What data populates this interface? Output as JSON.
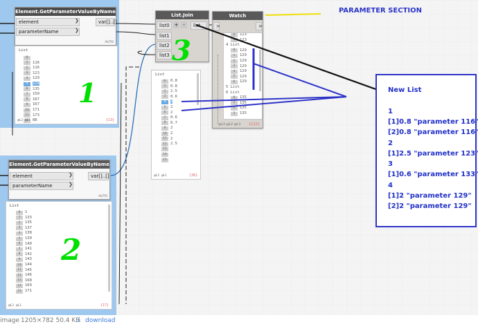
{
  "node_getparam_1": {
    "title": "Element.GetParameterValueByName",
    "inputs": [
      "element",
      "parameterName"
    ],
    "output": "var[]..[]",
    "lacing": "AUTO",
    "preview": {
      "title": "List",
      "items": [
        [
          "0",
          ""
        ],
        [
          "1",
          "116"
        ],
        [
          "2",
          "116"
        ],
        [
          "3",
          "123"
        ],
        [
          "4",
          "129"
        ],
        [
          "5",
          "129"
        ],
        [
          "6",
          "135"
        ],
        [
          "7",
          "150"
        ],
        [
          "8",
          "167"
        ],
        [
          "9",
          "167"
        ],
        [
          "10",
          "171"
        ],
        [
          "11",
          "173"
        ],
        [
          "12",
          "88"
        ]
      ],
      "highlight_index": 5,
      "levels": "@L2 @L1",
      "count": "{13}"
    }
  },
  "node_getparam_2": {
    "title": "Element.GetParameterValueByName",
    "inputs": [
      "element",
      "parameterName"
    ],
    "output": "var[]..[]",
    "lacing": "AUTO",
    "preview": {
      "title": "List",
      "items": [
        [
          "0",
          "1"
        ],
        [
          "1",
          "133"
        ],
        [
          "2",
          "135"
        ],
        [
          "3",
          "137"
        ],
        [
          "4",
          "138"
        ],
        [
          "5",
          "139"
        ],
        [
          "6",
          "140"
        ],
        [
          "7",
          "141"
        ],
        [
          "8",
          "142"
        ],
        [
          "9",
          "143"
        ],
        [
          "10",
          "144"
        ],
        [
          "11",
          "145"
        ],
        [
          "12",
          "146"
        ],
        [
          "13",
          "168"
        ],
        [
          "14",
          "169"
        ],
        [
          "15",
          "171"
        ]
      ],
      "levels": "@L2 @L1",
      "count": "{17}"
    }
  },
  "node_listjoin": {
    "title": "List.Join",
    "inputs": [
      "list0",
      "list1",
      "list2",
      "list3"
    ],
    "plus": "+",
    "minus": "-",
    "output": "list",
    "preview": {
      "title": "List",
      "items": [
        [
          "0",
          "0.8"
        ],
        [
          "1",
          "0.8"
        ],
        [
          "2",
          "2.5"
        ],
        [
          "3",
          "0.6"
        ],
        [
          "4",
          "2"
        ],
        [
          "5",
          "2"
        ],
        [
          "6",
          "2"
        ],
        [
          "7",
          "0.6"
        ],
        [
          "8",
          "0.7"
        ],
        [
          "9",
          "2"
        ],
        [
          "10",
          "2"
        ],
        [
          "11",
          "2"
        ],
        [
          "12",
          "2.5"
        ],
        [
          "13",
          ""
        ],
        [
          "14",
          ""
        ],
        [
          "15",
          ""
        ]
      ],
      "highlight_index": 4,
      "levels": "@L2 @L1",
      "count": "{38}"
    }
  },
  "node_watch": {
    "title": "Watch",
    "input": ">",
    "output": ">",
    "list_label": "List",
    "rows": [
      {
        "t": "idx",
        "i": "0",
        "v": "123"
      },
      {
        "t": "idx",
        "i": "1",
        "v": "123"
      },
      {
        "t": "head",
        "v": "4 List"
      },
      {
        "t": "idx",
        "i": "0",
        "v": "129"
      },
      {
        "t": "idx",
        "i": "1",
        "v": "129"
      },
      {
        "t": "idx",
        "i": "2",
        "v": "129"
      },
      {
        "t": "idx",
        "i": "3",
        "v": "129"
      },
      {
        "t": "idx",
        "i": "4",
        "v": "129"
      },
      {
        "t": "idx",
        "i": "5",
        "v": "129"
      },
      {
        "t": "idx",
        "i": "6",
        "v": "129"
      },
      {
        "t": "head",
        "v": "5 List"
      },
      {
        "t": "head",
        "v": "6 List"
      },
      {
        "t": "idx",
        "i": "0",
        "v": "135"
      },
      {
        "t": "idx",
        "i": "1",
        "v": "135"
      },
      {
        "t": "idx",
        "i": "2",
        "v": "135"
      },
      {
        "t": "idx",
        "i": "3",
        "v": "135"
      }
    ],
    "levels": "@L3 @L2 @L1",
    "count": "{112}"
  },
  "annotations": {
    "hand_1": "1",
    "hand_2": "2",
    "hand_3": "3",
    "parameter_section": "PARAMETER SECTION",
    "new_list": [
      "New List",
      "",
      "1",
      "[1]0.8 \"parameter 116\"",
      "[2]0.8 \"parameter 116\"",
      "2",
      "[1]2.5 \"parameter 123\"",
      "3",
      "[1]0.6 \"parameter 133\"",
      "4",
      "[1]2 \"parameter 129\"",
      "[2]2 \"parameter 129\""
    ]
  },
  "status": {
    "label": "image",
    "info": "1205×782 50.4 KB",
    "download": "download"
  },
  "colors": {
    "selection": "#9fc8ee",
    "node_header": "#595959",
    "annotation_blue": "#2c32c8",
    "annotation_green": "#00e000",
    "highlight_yellow": "#f0e020"
  }
}
